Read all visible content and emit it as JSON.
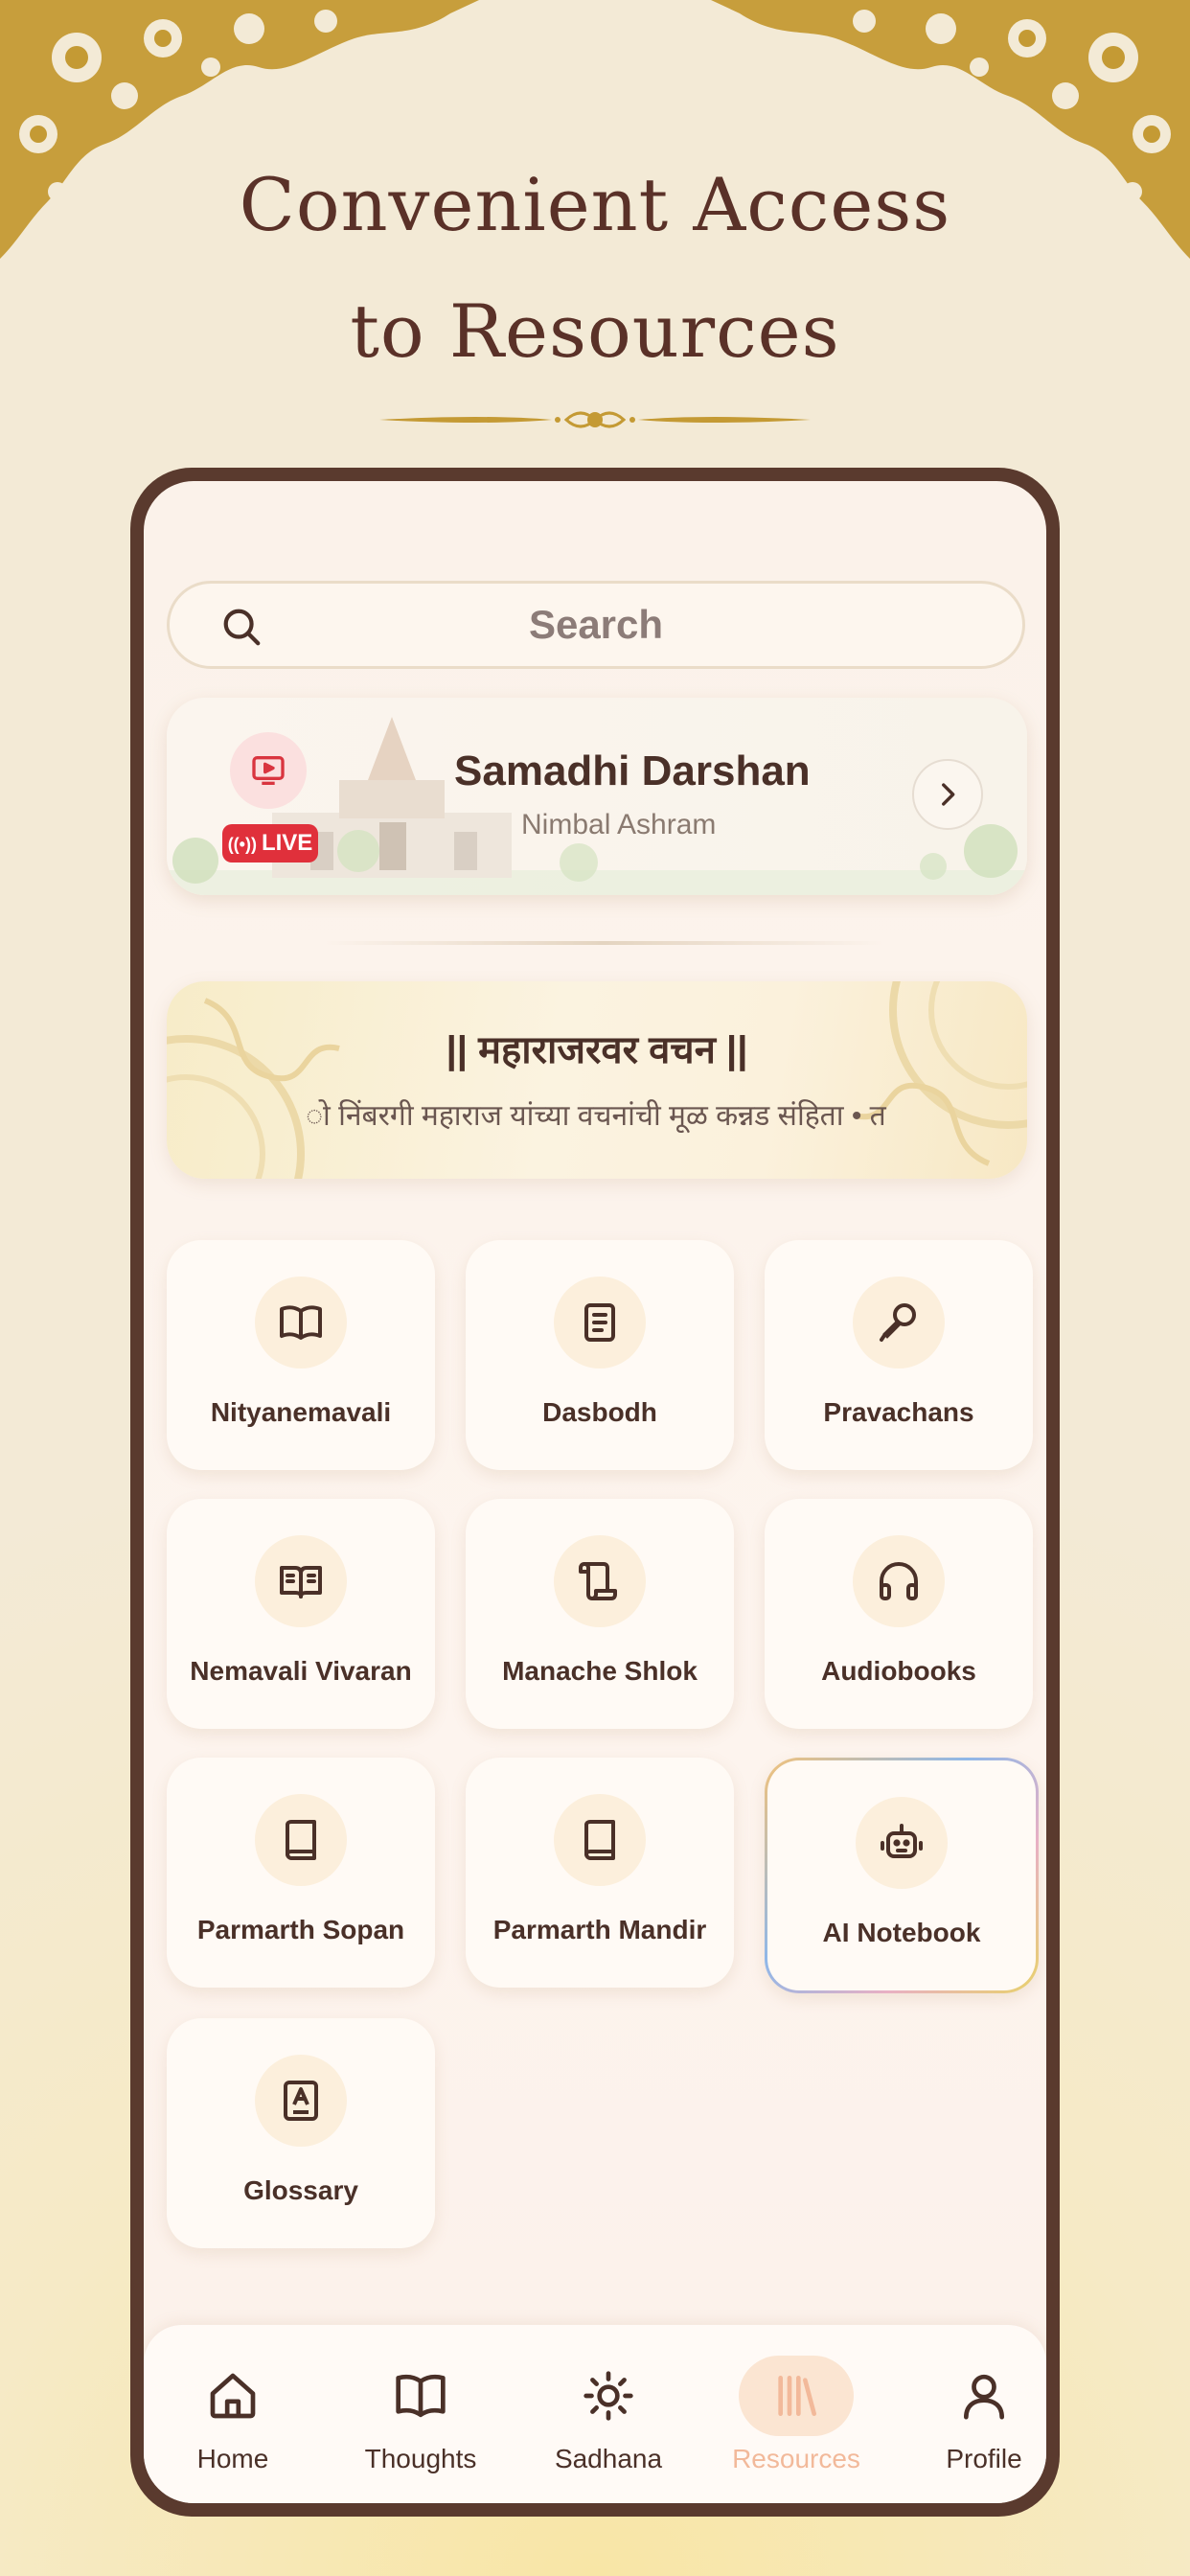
{
  "headline": {
    "line1": "Convenient Access",
    "line2": "to Resources"
  },
  "search": {
    "placeholder": "Search",
    "icon": "search-icon"
  },
  "live_card": {
    "title": "Samadhi Darshan",
    "subtitle": "Nimbal Ashram",
    "badge": "LIVE",
    "icon": "tv-icon"
  },
  "quote_card": {
    "title": "|| महाराजरवर वचन ||",
    "text": "ो निंबरगी महाराज यांच्या वचनांची मूळ कन्नड संहिता  •  त"
  },
  "resources": [
    {
      "label": "Nityanemavali",
      "icon": "open-book-icon"
    },
    {
      "label": "Dasbodh",
      "icon": "document-icon"
    },
    {
      "label": "Pravachans",
      "icon": "microphone-icon"
    },
    {
      "label": "Nemavali Vivaran",
      "icon": "reading-book-icon"
    },
    {
      "label": "Manache Shlok",
      "icon": "scroll-icon"
    },
    {
      "label": "Audiobooks",
      "icon": "headphones-icon"
    },
    {
      "label": "Parmarth Sopan",
      "icon": "book-icon"
    },
    {
      "label": "Parmarth Mandir",
      "icon": "book-icon"
    },
    {
      "label": "AI Notebook",
      "icon": "robot-icon"
    },
    {
      "label": "Glossary",
      "icon": "glossary-icon"
    }
  ],
  "tabs": [
    {
      "label": "Home",
      "icon": "home-icon"
    },
    {
      "label": "Thoughts",
      "icon": "book-open-icon"
    },
    {
      "label": "Sadhana",
      "icon": "sun-icon"
    },
    {
      "label": "Resources",
      "icon": "library-icon",
      "active": true
    },
    {
      "label": "Profile",
      "icon": "user-icon"
    }
  ],
  "colors": {
    "accent_brown": "#5a3128",
    "gold": "#c9a137",
    "live_red": "#e0303b",
    "active_tab": "#f2b99a"
  }
}
